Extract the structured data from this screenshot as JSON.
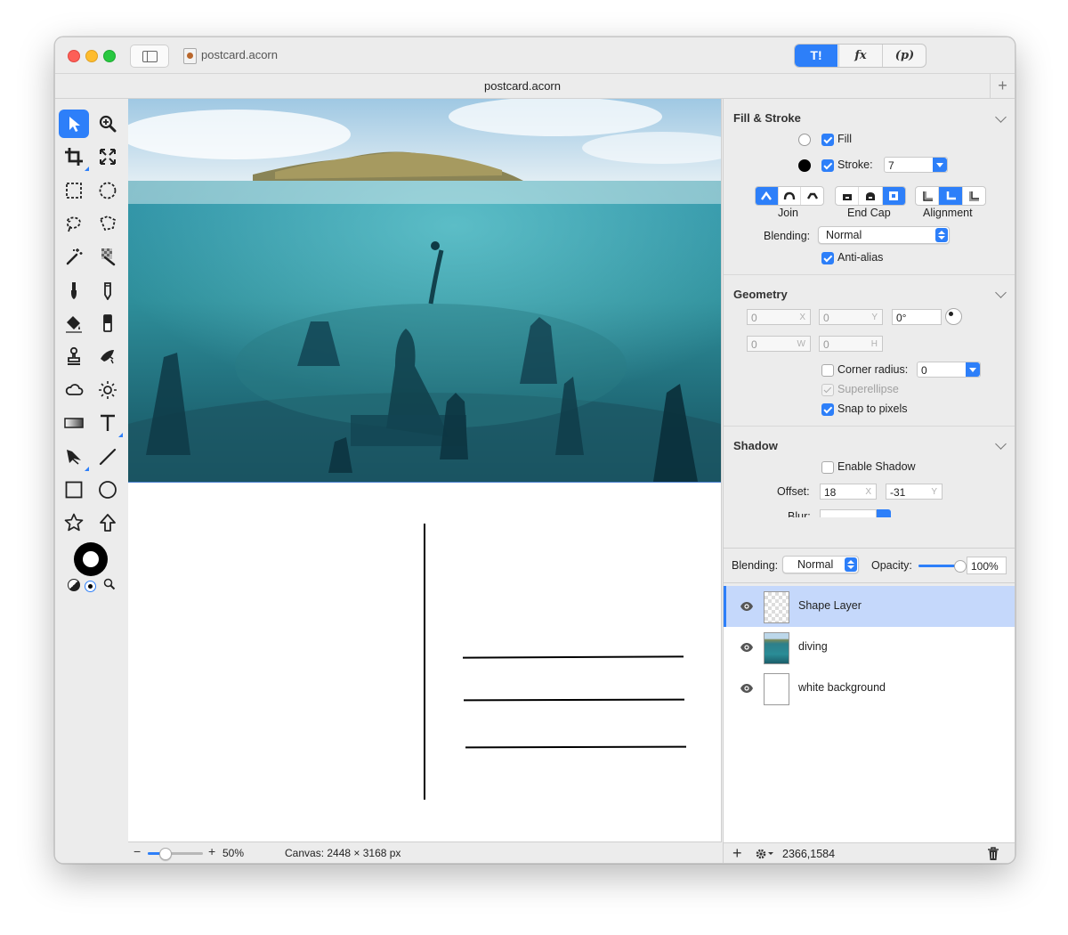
{
  "window": {
    "title": "postcard.acorn",
    "tab_title": "postcard.acorn",
    "tab_add": "+",
    "seg_tools": "T!",
    "seg_fx": "fx",
    "seg_p": "(p)"
  },
  "tools": [
    "select-arrow-icon",
    "zoom-icon",
    "crop-icon",
    "transform-icon",
    "rect-select-icon",
    "ellipse-select-icon",
    "lasso-icon",
    "polygon-lasso-icon",
    "magic-wand-icon",
    "color-select-icon",
    "brush-icon",
    "pencil-icon",
    "paint-bucket-icon",
    "eraser-icon",
    "clone-stamp-icon",
    "retouch-icon",
    "cloud-icon",
    "sun-icon",
    "gradient-icon",
    "text-icon",
    "bezier-pen-icon",
    "line-icon",
    "rectangle-shape-icon",
    "oval-shape-icon",
    "star-shape-icon",
    "arrow-shape-icon"
  ],
  "status": {
    "zoom_minus": "−",
    "zoom_plus": "+",
    "zoom_level": 0.3,
    "zoom": "50%",
    "canvas_size": "Canvas: 2448 × 3168 px"
  },
  "fill_stroke": {
    "title": "Fill & Stroke",
    "fill_label": "Fill",
    "stroke_label": "Stroke:",
    "stroke_value": "7",
    "join_label": "Join",
    "endcap_label": "End Cap",
    "alignment_label": "Alignment",
    "blending_label": "Blending:",
    "blending_value": "Normal",
    "antialias_label": "Anti-alias"
  },
  "geometry": {
    "title": "Geometry",
    "x": "0",
    "x_suffix": "X",
    "y": "0",
    "y_suffix": "Y",
    "angle": "0°",
    "w": "0",
    "w_suffix": "W",
    "h": "0",
    "h_suffix": "H",
    "corner_label": "Corner radius:",
    "corner_value": "0",
    "superellipse_label": "Superellipse",
    "snap_label": "Snap to pixels"
  },
  "shadow": {
    "title": "Shadow",
    "enable_label": "Enable Shadow",
    "offset_label": "Offset:",
    "offset_x": "18",
    "offset_x_suffix": "X",
    "offset_y": "-31",
    "offset_y_suffix": "Y",
    "blur_label": "Blur:"
  },
  "layers_bar": {
    "blending_label": "Blending:",
    "blending_value": "Normal",
    "opacity_label": "Opacity:",
    "opacity_value": "100%",
    "opacity_level": 1.0
  },
  "layers": [
    {
      "name": "Shape Layer",
      "selected": true
    },
    {
      "name": "diving",
      "selected": false
    },
    {
      "name": "white background",
      "selected": false
    }
  ],
  "layers_footer": {
    "add": "+",
    "coords": "2366,1584"
  },
  "colors": {
    "accent": "#2d7ff9",
    "selection": "#c5d8fb"
  }
}
